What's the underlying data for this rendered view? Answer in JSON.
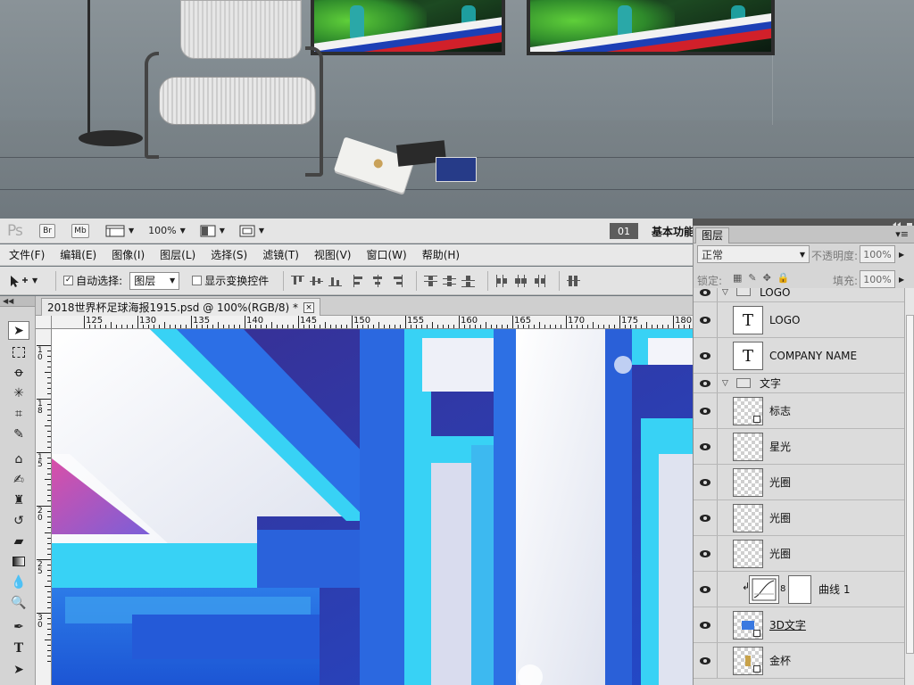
{
  "app": {
    "logo": "Ps",
    "bridge_btn": "Br",
    "minibridge_btn": "Mb",
    "zoom": "100%",
    "workspace_badge": "01",
    "workspace_label": "基本功能"
  },
  "menu": [
    "文件(F)",
    "编辑(E)",
    "图像(I)",
    "图层(L)",
    "选择(S)",
    "滤镜(T)",
    "视图(V)",
    "窗口(W)",
    "帮助(H)"
  ],
  "options": {
    "auto_select_label": "自动选择:",
    "auto_select_checked": true,
    "auto_select_value": "图层",
    "show_transform_label": "显示变换控件",
    "show_transform_checked": false
  },
  "document": {
    "tab_title": "2018世界杯足球海报1915.psd @ 100%(RGB/8) *",
    "tab_close": "×",
    "ruler_top": [
      "125",
      "130",
      "135",
      "140",
      "145",
      "150",
      "155",
      "160",
      "165",
      "170",
      "175",
      "180"
    ],
    "ruler_left": [
      "1\n0",
      "1\n8",
      "1\n5",
      "2\n0",
      "2\n5",
      "3\n0"
    ]
  },
  "tools_panel_header": "◀◀",
  "layers_panel": {
    "tab_label": "图层",
    "blend_mode": "正常",
    "opacity_label": "不透明度:",
    "opacity_value": "100%",
    "lock_label": "锁定:",
    "fill_label": "填充:",
    "fill_value": "100%",
    "layers": [
      {
        "name": "LOGO",
        "type": "group",
        "visible": true
      },
      {
        "name": "LOGO",
        "type": "text",
        "visible": true
      },
      {
        "name": "COMPANY NAME",
        "type": "text",
        "visible": true
      },
      {
        "name": "文字",
        "type": "group",
        "visible": true
      },
      {
        "name": "标志",
        "type": "smart",
        "visible": true
      },
      {
        "name": "星光",
        "type": "pixel",
        "visible": true
      },
      {
        "name": "光圈",
        "type": "pixel",
        "visible": true
      },
      {
        "name": "光圈",
        "type": "pixel",
        "visible": true
      },
      {
        "name": "光圈",
        "type": "pixel",
        "visible": true
      },
      {
        "name": "曲线 1",
        "type": "adjustment",
        "visible": true
      },
      {
        "name": "3D文字",
        "type": "smart",
        "visible": true
      },
      {
        "name": "金杯",
        "type": "smart",
        "visible": true
      }
    ]
  },
  "colors": {
    "canvas_blue": "#2a5fd6",
    "canvas_cyan": "#38d2f5",
    "panel_bg": "#d6d6d6"
  }
}
